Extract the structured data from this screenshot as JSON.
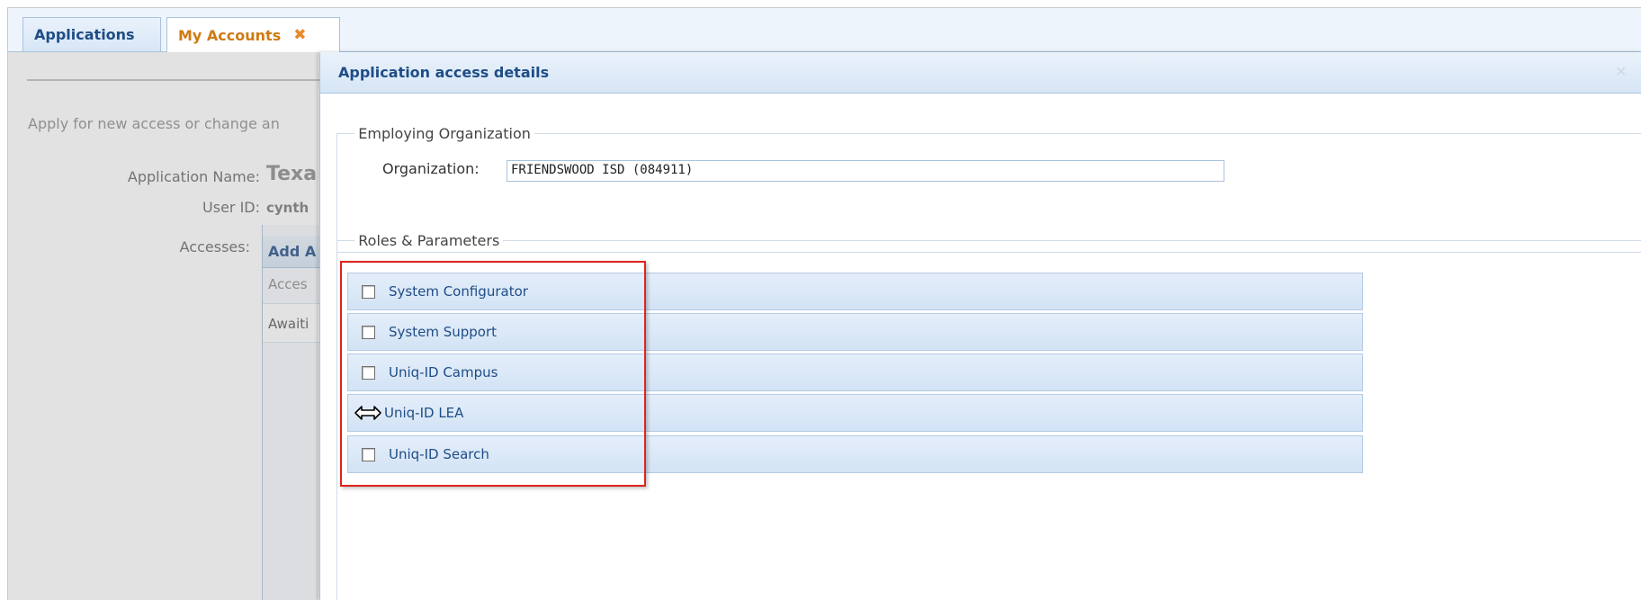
{
  "tabs": [
    {
      "label": "Applications",
      "active": false
    },
    {
      "label": "My Accounts",
      "active": true,
      "close_glyph": "✖"
    }
  ],
  "background_page": {
    "intro_text": "Apply for new access or change an",
    "application_name_label": "Application Name:",
    "application_name_value": "Texa",
    "user_id_label": "User ID:",
    "user_id_value": "cynth",
    "accesses_label": "Accesses:",
    "add_button_label": "Add A",
    "grid_header": "Acces",
    "grid_row_status": "Awaiti"
  },
  "dialog": {
    "title": "Application access details",
    "employing_org": {
      "legend": "Employing Organization",
      "label": "Organization:",
      "value": "FRIENDSWOOD ISD (084911)"
    },
    "roles": {
      "legend": "Roles & Parameters",
      "items": [
        {
          "label": "System Configurator",
          "checked": false
        },
        {
          "label": "System Support",
          "checked": false
        },
        {
          "label": "Uniq-ID Campus",
          "checked": false
        },
        {
          "label": "Uniq-ID LEA",
          "checked": false,
          "cursor": "resize-horizontal-icon"
        },
        {
          "label": "Uniq-ID Search",
          "checked": false
        }
      ]
    }
  },
  "colors": {
    "accent_blue": "#1f4d86",
    "active_tab_text": "#d07a12",
    "highlight_red": "#e0231e"
  }
}
